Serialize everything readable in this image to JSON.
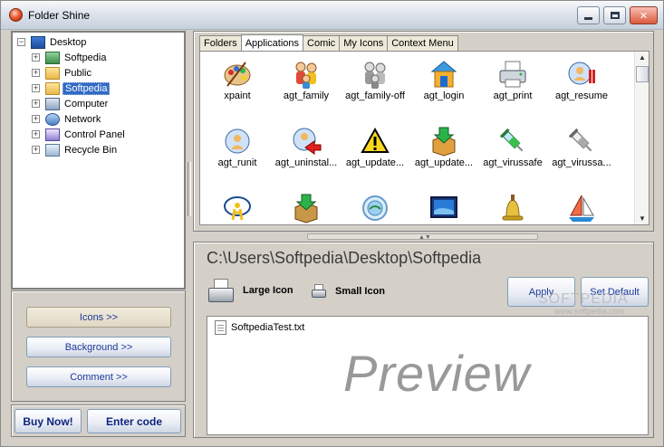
{
  "window": {
    "title": "Folder Shine"
  },
  "tree": {
    "items": [
      {
        "label": "Desktop",
        "icon": "desktop-icon"
      },
      {
        "label": "Softpedia",
        "icon": "softpedia-folder-icon"
      },
      {
        "label": "Public",
        "icon": "folder-icon"
      },
      {
        "label": "Softpedia",
        "icon": "folder-icon",
        "selected": true
      },
      {
        "label": "Computer",
        "icon": "computer-icon"
      },
      {
        "label": "Network",
        "icon": "network-icon"
      },
      {
        "label": "Control Panel",
        "icon": "control-panel-icon"
      },
      {
        "label": "Recycle Bin",
        "icon": "recycle-bin-icon"
      }
    ]
  },
  "left_buttons": {
    "icons": "Icons >>",
    "background": "Background >>",
    "comment": "Comment >>",
    "buy_now": "Buy Now!",
    "enter_code": "Enter code"
  },
  "tabs": [
    "Folders",
    "Applications",
    "Comic",
    "My Icons",
    "Context Menu"
  ],
  "active_tab": "Applications",
  "icons": [
    {
      "label": "xpaint",
      "icon": "paint-palette-icon"
    },
    {
      "label": "agt_family",
      "icon": "family-icon"
    },
    {
      "label": "agt_family-off",
      "icon": "family-off-icon"
    },
    {
      "label": "agt_login",
      "icon": "login-house-icon"
    },
    {
      "label": "agt_print",
      "icon": "printer-icon"
    },
    {
      "label": "agt_resume",
      "icon": "resume-icon"
    },
    {
      "label": "agt_runit",
      "icon": "runit-icon"
    },
    {
      "label": "agt_uninstal...",
      "icon": "uninstall-icon"
    },
    {
      "label": "agt_update...",
      "icon": "warning-icon"
    },
    {
      "label": "agt_update...",
      "icon": "update-box-icon"
    },
    {
      "label": "agt_virussafe",
      "icon": "syringe-icon"
    },
    {
      "label": "agt_virussa...",
      "icon": "syringe-gray-icon"
    },
    {
      "label": "",
      "icon": "aim-chat-icon"
    },
    {
      "label": "",
      "icon": "download-box-icon"
    },
    {
      "label": "",
      "icon": "globe-icon"
    },
    {
      "label": "",
      "icon": "monitor-icon"
    },
    {
      "label": "",
      "icon": "bell-icon"
    },
    {
      "label": "",
      "icon": "sailboat-icon"
    }
  ],
  "preview": {
    "path": "C:\\Users\\Softpedia\\Desktop\\Softpedia",
    "large_icon": "Large Icon",
    "small_icon": "Small Icon",
    "apply": "Apply",
    "set_default": "Set Default",
    "watermark": "SOFTPEDIA",
    "watermark_url": "www.softpedia.com",
    "file_name": "SoftpediaTest.txt",
    "preview_word": "Preview"
  },
  "colors": {
    "selection": "#316AC5",
    "panel": "#D4D0C8"
  }
}
